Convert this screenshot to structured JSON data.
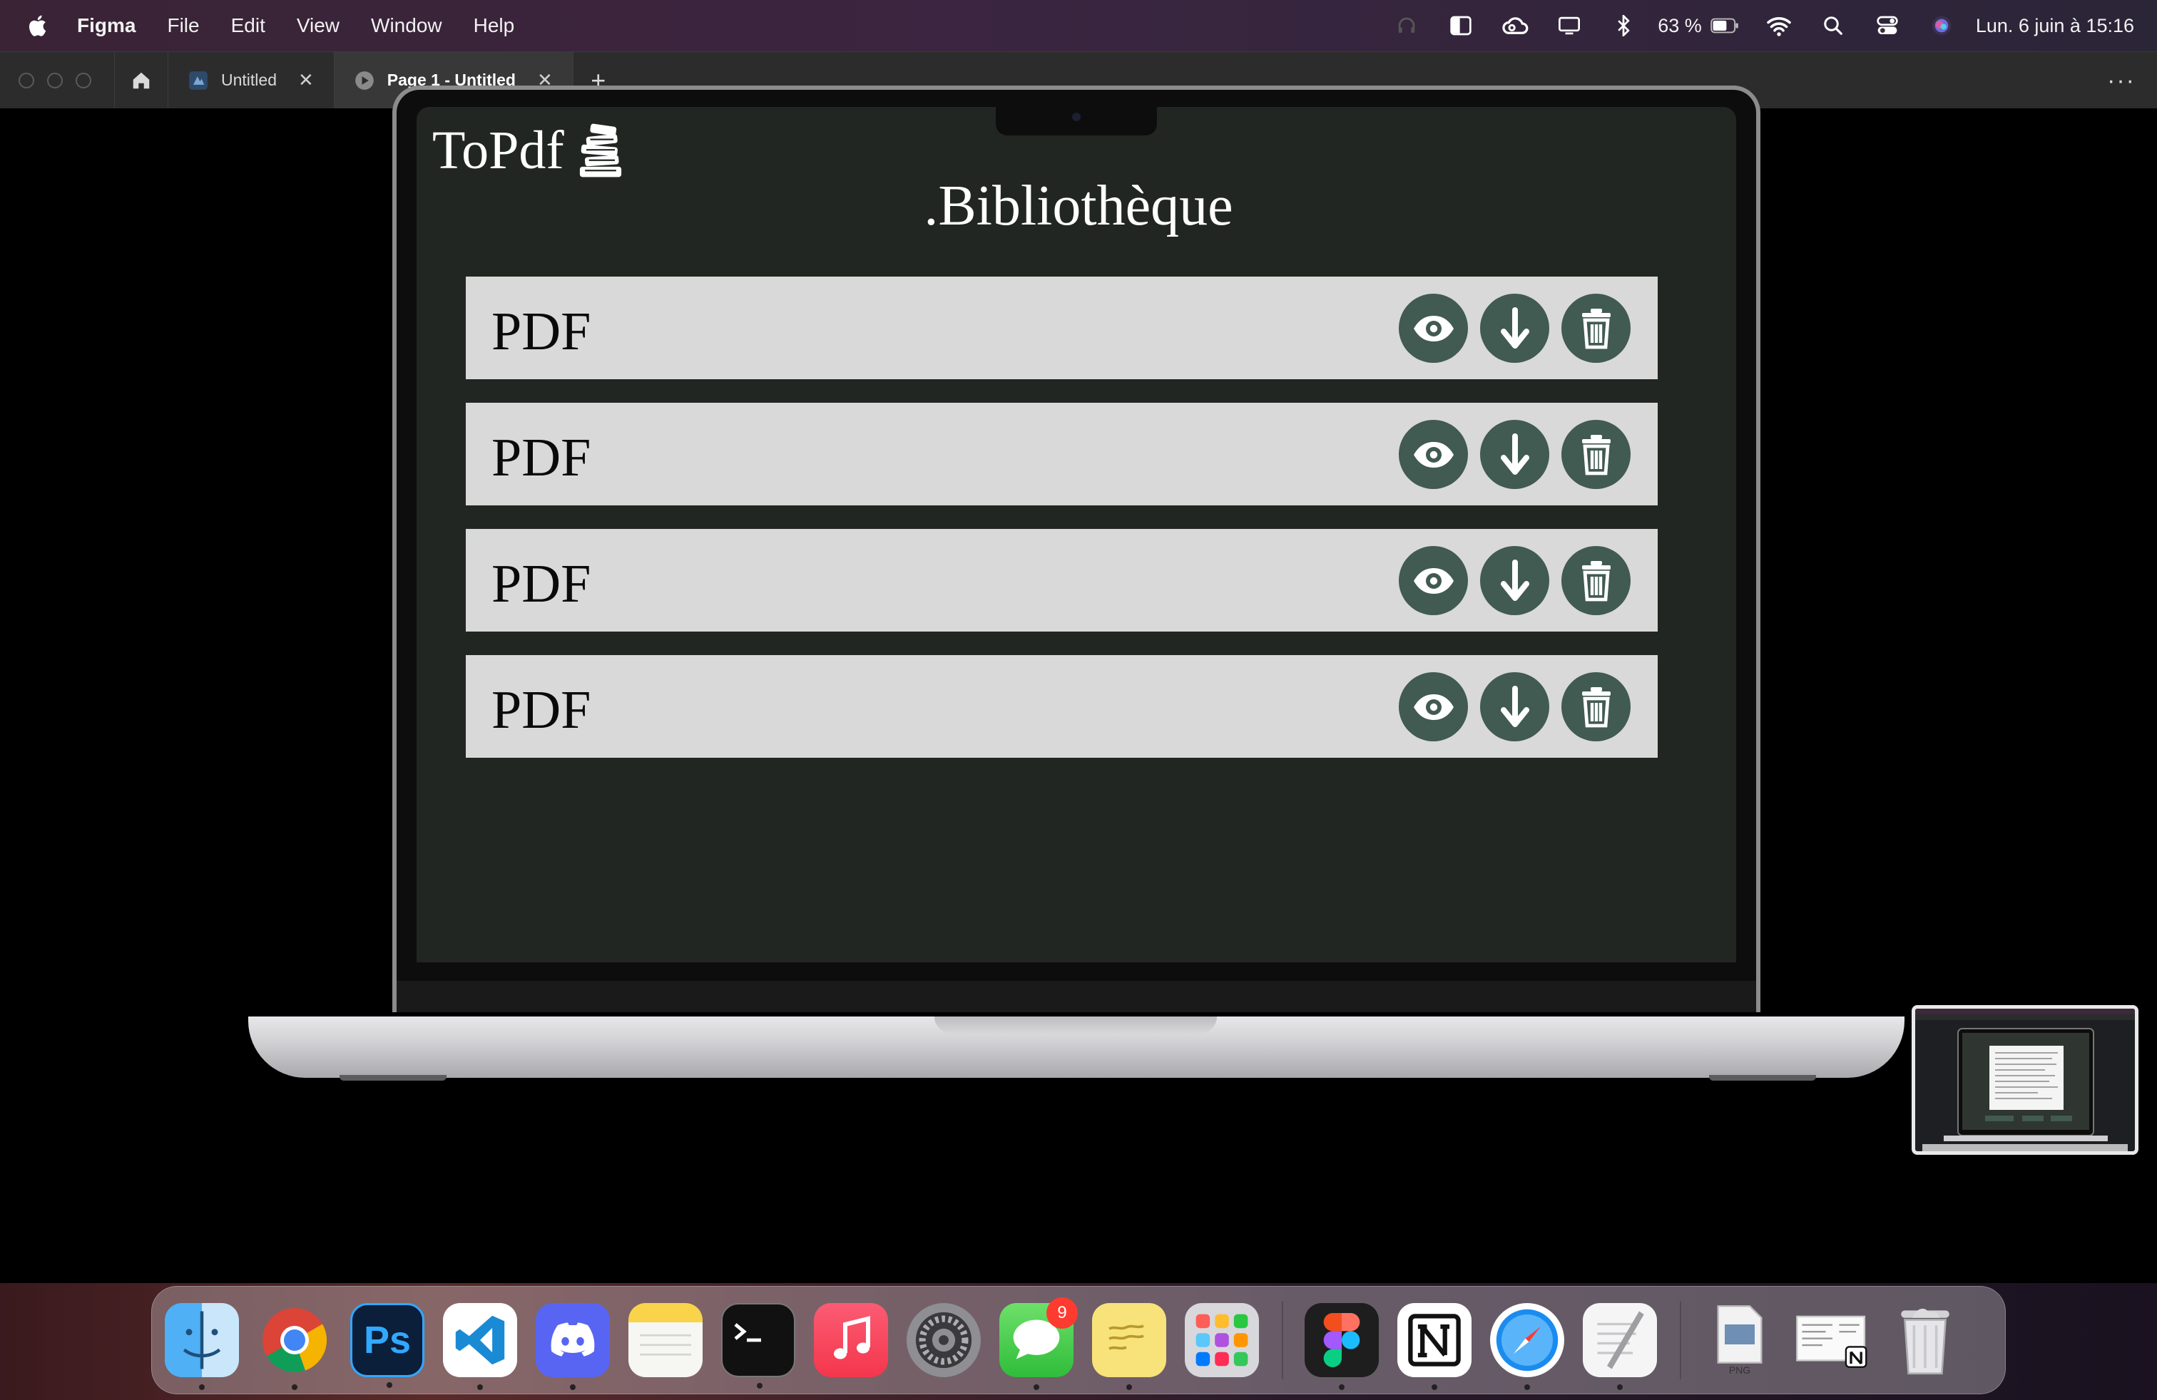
{
  "menubar": {
    "app_name": "Figma",
    "menus": [
      "File",
      "Edit",
      "View",
      "Window",
      "Help"
    ],
    "battery_percent": "63 %",
    "datetime": "Lun. 6 juin à  15:16"
  },
  "tabbar": {
    "tabs": [
      {
        "label": "Untitled",
        "close": "✕"
      },
      {
        "label": "Page 1 - Untitled",
        "close": "✕"
      }
    ],
    "add_tab": "+",
    "more": "···"
  },
  "app": {
    "logo_text": "ToPdf",
    "title": ".Bibliothèque",
    "rows": [
      {
        "label": "PDF"
      },
      {
        "label": "PDF"
      },
      {
        "label": "PDF"
      },
      {
        "label": "PDF"
      }
    ],
    "actions": [
      "eye-icon",
      "download-icon",
      "trash-icon"
    ],
    "button_color": "#415a52",
    "row_color": "#d9d9d9",
    "screen_color": "#222622"
  },
  "dock": {
    "apps": [
      "Finder",
      "Chrome",
      "Photoshop",
      "VS Code",
      "Discord",
      "Notes",
      "Terminal",
      "Music",
      "System Preferences",
      "Messages",
      "Stickies",
      "Launchpad",
      "Figma",
      "Notion",
      "Safari",
      "TextEdit",
      "Downloads",
      "Screenshot",
      "Trash"
    ],
    "photoshop_label": "Ps",
    "messages_badge": "9",
    "png_label": "PNG"
  }
}
